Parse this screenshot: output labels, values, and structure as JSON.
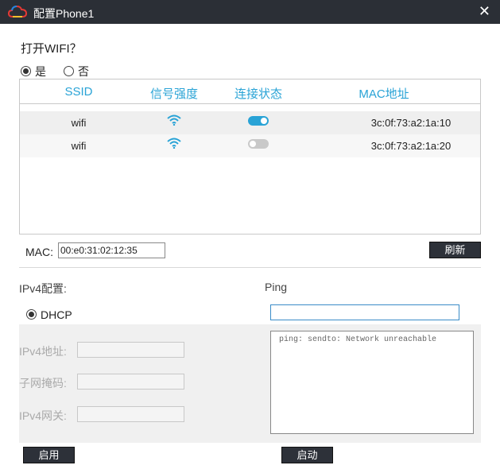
{
  "window": {
    "title": "配置Phone1",
    "logo_icon": "cloud-icon",
    "close_label": "✕"
  },
  "wifi_section": {
    "question": "打开WIFI？",
    "options": [
      {
        "label": "是",
        "selected": true
      },
      {
        "label": "否",
        "selected": false
      }
    ],
    "columns": [
      "SSID",
      "信号强度",
      "连接状态",
      "MAC地址"
    ],
    "rows": [
      {
        "ssid": "wifi",
        "signal_icon": "wifi-signal-icon",
        "connected": true,
        "mac": "3c:0f:73:a2:1a:10"
      },
      {
        "ssid": "wifi",
        "signal_icon": "wifi-signal-icon",
        "connected": false,
        "mac": "3c:0f:73:a2:1a:20"
      }
    ],
    "accent_color": "#29a3d6"
  },
  "mac": {
    "label": "MAC:",
    "value": "00:e0:31:02:12:35",
    "refresh_label": "刷新"
  },
  "ipv4": {
    "title": "IPv4配置:",
    "dhcp_label": "DHCP",
    "dhcp_selected": true,
    "fields": [
      {
        "label": "IPv4地址:",
        "value": ""
      },
      {
        "label": "子网掩码:",
        "value": ""
      },
      {
        "label": "IPv4网关:",
        "value": ""
      }
    ],
    "enable_label": "启用"
  },
  "ping": {
    "title": "Ping",
    "input_value": "",
    "output": "ping: sendto: Network unreachable",
    "start_label": "启动"
  }
}
